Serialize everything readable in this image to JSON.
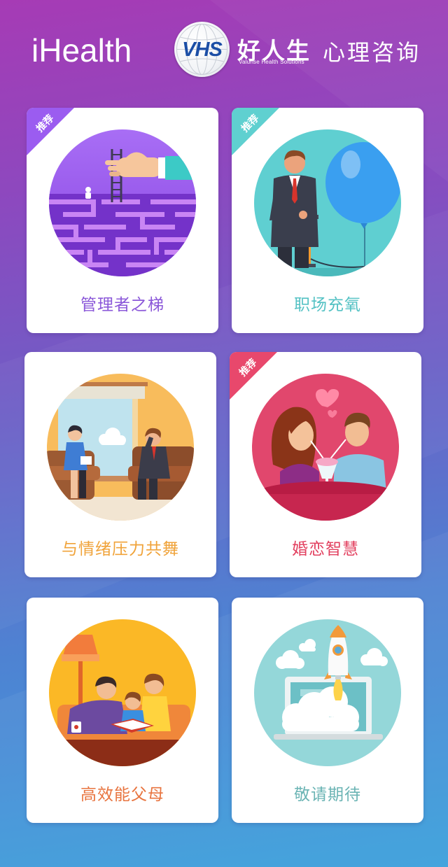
{
  "header": {
    "brand": "iHealth",
    "logo_mark": "VHS",
    "logo_name": "好人生",
    "logo_tagline": "Valurise Health Solutions",
    "title": "心理咨询"
  },
  "colors": {
    "bg_top": "#a63bb5",
    "bg_bottom": "#3aa0dc",
    "card": "#ffffff"
  },
  "cards": [
    {
      "label": "管理者之梯",
      "badge": "推荐",
      "label_color": "#8b58d9",
      "badge_color": "#9b5cf0",
      "icon": "maze-ladder-illustration"
    },
    {
      "label": "职场充氧",
      "badge": "推荐",
      "label_color": "#55c2c4",
      "badge_color": "#5fd0d0",
      "icon": "balloon-pump-illustration"
    },
    {
      "label": "与情绪压力共舞",
      "label_color": "#f0a33a",
      "icon": "counseling-session-illustration"
    },
    {
      "label": "婚恋智慧",
      "badge": "推荐",
      "label_color": "#e2405f",
      "badge_color": "#e8486c",
      "icon": "couple-date-illustration"
    },
    {
      "label": "高效能父母",
      "label_color": "#e8743f",
      "icon": "family-reading-illustration"
    },
    {
      "label": "敬请期待",
      "label_color": "#6bb4b4",
      "icon": "rocket-launch-illustration"
    }
  ]
}
